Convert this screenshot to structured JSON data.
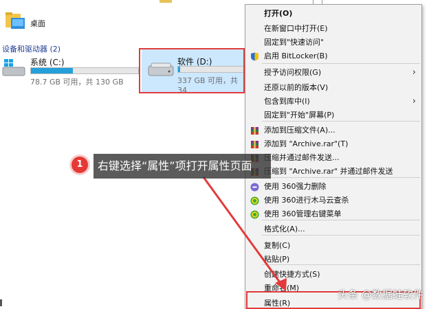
{
  "explorer": {
    "desktop_label": "桌面",
    "section_label": "设备和驱动器 (2)",
    "drives": [
      {
        "name": "系统 (C:)",
        "sub": "78.7 GB 可用，共 130 GB",
        "used_fraction": 0.39
      },
      {
        "name": "软件 (D:)",
        "sub": "337 GB 可用，共 34",
        "used_fraction": 0.03
      }
    ]
  },
  "context_menu": {
    "items": [
      {
        "label": "打开(O)",
        "bold": true
      },
      {
        "label": "在新窗口中打开(E)"
      },
      {
        "label": "固定到\"快速访问\""
      },
      {
        "label": "启用 BitLocker(B)",
        "icon": "shield-icon"
      },
      {
        "label": "授予访问权限(G)",
        "submenu": true
      },
      {
        "label": "还原以前的版本(V)"
      },
      {
        "label": "包含到库中(I)",
        "submenu": true
      },
      {
        "label": "固定到\"开始\"屏幕(P)"
      },
      {
        "label": "添加到压缩文件(A)...",
        "icon": "winrar-icon"
      },
      {
        "label": "添加到 \"Archive.rar\"(T)",
        "icon": "winrar-icon"
      },
      {
        "label": "压缩并通过邮件发送...",
        "icon": "winrar-icon"
      },
      {
        "label": "压缩到 \"Archive.rar\" 并通过邮件发送",
        "icon": "winrar-icon"
      },
      {
        "label": "使用 360强力删除",
        "icon": "360-delete-icon"
      },
      {
        "label": "使用 360进行木马云查杀",
        "icon": "360-scan-icon"
      },
      {
        "label": "使用 360管理右键菜单",
        "icon": "360-manage-icon"
      },
      {
        "label": "格式化(A)..."
      },
      {
        "label": "复制(C)"
      },
      {
        "label": "粘贴(P)"
      },
      {
        "label": "创建快捷方式(S)"
      },
      {
        "label": "重命名(M)"
      },
      {
        "label": "属性(R)"
      }
    ]
  },
  "callout": {
    "number": "1",
    "text": "右键选择“属性”项打开属性页面"
  },
  "watermark": "头条 @数据蛙软件",
  "colors": {
    "highlight": "#e23a3a",
    "drive_fill": "#26a0da",
    "section_blue": "#1f3a93"
  }
}
